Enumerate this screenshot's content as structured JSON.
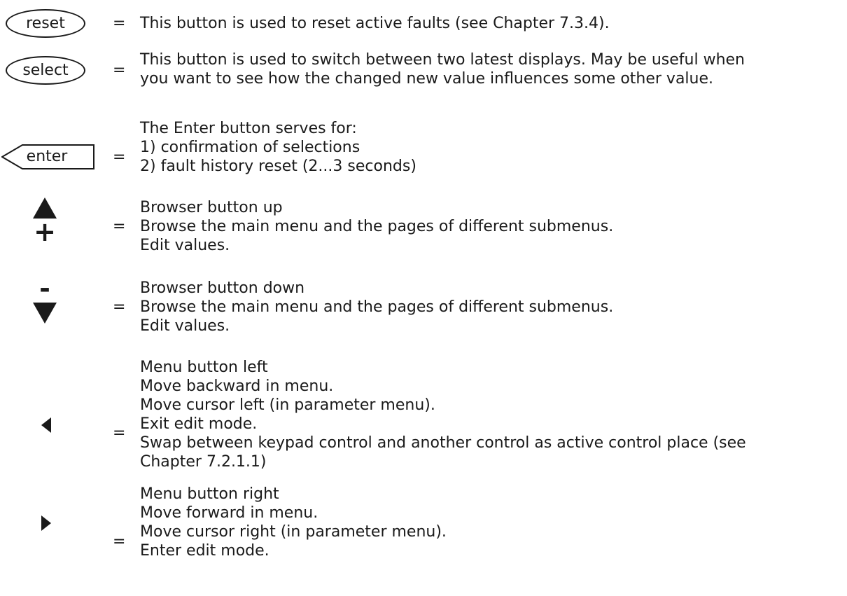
{
  "rows": [
    {
      "button": "reset",
      "equals": "=",
      "lines": [
        "This button is used to reset active faults (see Chapter 7.3.4)."
      ]
    },
    {
      "button": "select",
      "equals": "=",
      "lines": [
        "This button is used to switch between two latest displays. May be useful when",
        "you want to see how the changed new value influences some other value."
      ]
    },
    {
      "button": "enter",
      "equals": "=",
      "lines": [
        "The Enter button serves for:",
        "1) confirmation of selections",
        "2) fault history reset (2...3 seconds)"
      ]
    },
    {
      "button_icon": "up-triangle-icon",
      "button_symbol": "+",
      "equals": "=",
      "lines": [
        "Browser button up",
        "Browse the main menu and the pages of different submenus.",
        "Edit values."
      ]
    },
    {
      "button_icon": "down-triangle-icon",
      "button_symbol": "-",
      "equals": "=",
      "lines": [
        "Browser button down",
        "Browse the main menu and the pages of different submenus.",
        "Edit values."
      ]
    },
    {
      "button_icon": "left-triangle-icon",
      "equals": "=",
      "lines": [
        "Menu button left",
        "Move backward in menu.",
        "Move cursor left (in parameter menu).",
        "Exit edit mode.",
        "Swap between keypad control and another control as active control place (see",
        "Chapter 7.2.1.1)"
      ]
    },
    {
      "button_icon": "right-triangle-icon",
      "equals": "=",
      "lines": [
        "Menu button right",
        "Move forward in menu.",
        "Move cursor right (in parameter menu).",
        "Enter edit mode."
      ]
    }
  ]
}
